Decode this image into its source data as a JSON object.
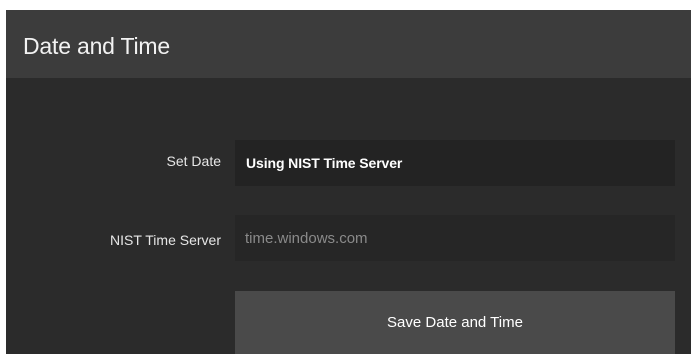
{
  "panel": {
    "title": "Date and Time"
  },
  "form": {
    "set_date": {
      "label": "Set Date",
      "value": "Using NIST Time Server"
    },
    "nist_server": {
      "label": "NIST Time Server",
      "value": "time.windows.com"
    },
    "save_label": "Save Date and Time"
  },
  "colors": {
    "panel_background": "#2b2b2b",
    "header_background": "#3c3c3c",
    "field_background": "#232323",
    "button_background": "#4a4a4a",
    "text_primary": "#ffffff",
    "text_muted": "#8a8a8a"
  }
}
